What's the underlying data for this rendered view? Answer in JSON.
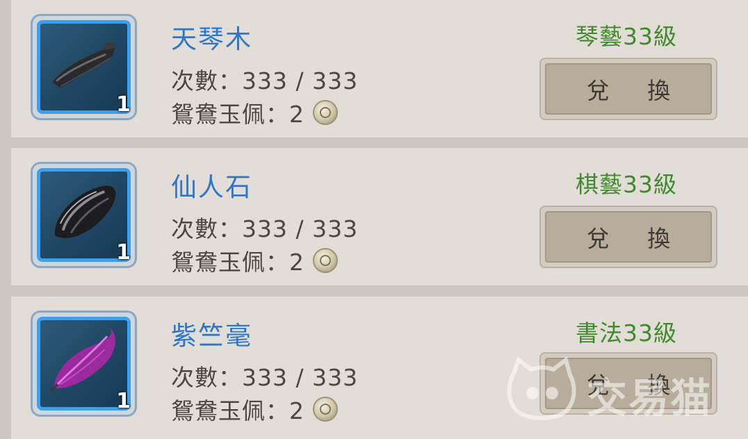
{
  "items": [
    {
      "name": "天琴木",
      "times": "次數：333 / 333",
      "cost": "鴛鴦玉佩：2",
      "count": "1",
      "requirement": "琴藝33級",
      "button": "兌 換",
      "icon": "dark-wood-icon"
    },
    {
      "name": "仙人石",
      "times": "次數：333 / 333",
      "cost": "鴛鴦玉佩：2",
      "count": "1",
      "requirement": "棋藝33級",
      "button": "兌 換",
      "icon": "black-stone-icon"
    },
    {
      "name": "紫竺毫",
      "times": "次數：333 / 333",
      "cost": "鴛鴦玉佩：2",
      "count": "1",
      "requirement": "書法33級",
      "button": "兌 換",
      "icon": "purple-feather-icon"
    }
  ],
  "watermark": "交易猫",
  "colors": {
    "name": "#2f76c8",
    "requirement": "#3f8a2c",
    "icon_border": "#3aa0ef"
  }
}
